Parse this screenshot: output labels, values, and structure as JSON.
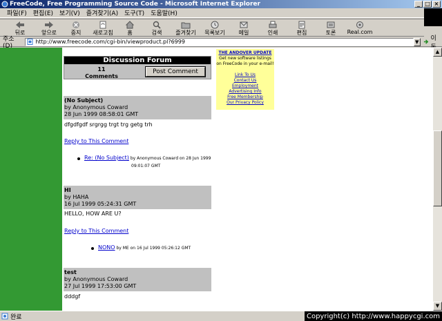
{
  "window": {
    "title": "FreeCode, Free Programming Source Code - Microsoft Internet Explorer",
    "controls": [
      "_",
      "□",
      "×"
    ]
  },
  "menu": [
    "파일(F)",
    "편집(E)",
    "보기(V)",
    "즐겨찾기(A)",
    "도구(T)",
    "도움말(H)"
  ],
  "toolbar": {
    "back": "뒤로",
    "forward": "앞으로",
    "stop": "중지",
    "refresh": "새로고침",
    "home": "홈",
    "search": "검색",
    "favorites": "즐겨찾기",
    "history": "목록보기",
    "mail": "메일",
    "print": "인쇄",
    "edit": "편집",
    "discuss": "토론",
    "real": "Real.com"
  },
  "address": {
    "label": "주소(D)",
    "url": "http://www.freecode.com/cgi-bin/viewproduct.pl?6999",
    "go": "이동"
  },
  "forum": {
    "title": "Discussion Forum",
    "count_number": "11",
    "count_label": "Comments",
    "post_button": "Post Comment"
  },
  "andover": {
    "title": "THE ANDOVER UPDATE",
    "body": "Get new software listings on FreeCode in your e-mail!",
    "links": [
      "Link To Us",
      "Contact Us",
      "Employment",
      "Advertising Info",
      "Free Membership",
      "Our Privacy Policy"
    ]
  },
  "comments": [
    {
      "subject": "(No Subject)",
      "author": "by Anonymous Coward",
      "date": "28 Jun 1999 08:58:01 GMT",
      "body": "dfgdfgdf srgrgg trgt trg getg trh",
      "reply": "Reply to This Comment",
      "subreply_link": "Re: (No Subject)",
      "subreply_meta1": "by Anonymous Coward on 28 Jun 1999",
      "subreply_meta2": "09:01:07 GMT"
    },
    {
      "subject": "HI",
      "author": "by HAHA",
      "date": "16 Jul 1999 05:24:31 GMT",
      "body": "HELLO, HOW ARE U?",
      "reply": "Reply to This Comment",
      "subreply_link": "NONO",
      "subreply_meta1": "by ME on 16 Jul 1999 05:26:12 GMT"
    },
    {
      "subject": "test",
      "author": "by Anonymous Coward",
      "date": "27 Jul 1999 17:53:00 GMT",
      "body": "dddgf"
    }
  ],
  "status": {
    "text": "완료",
    "copyright": "Copyright(c) http://www.happycgi.com"
  }
}
